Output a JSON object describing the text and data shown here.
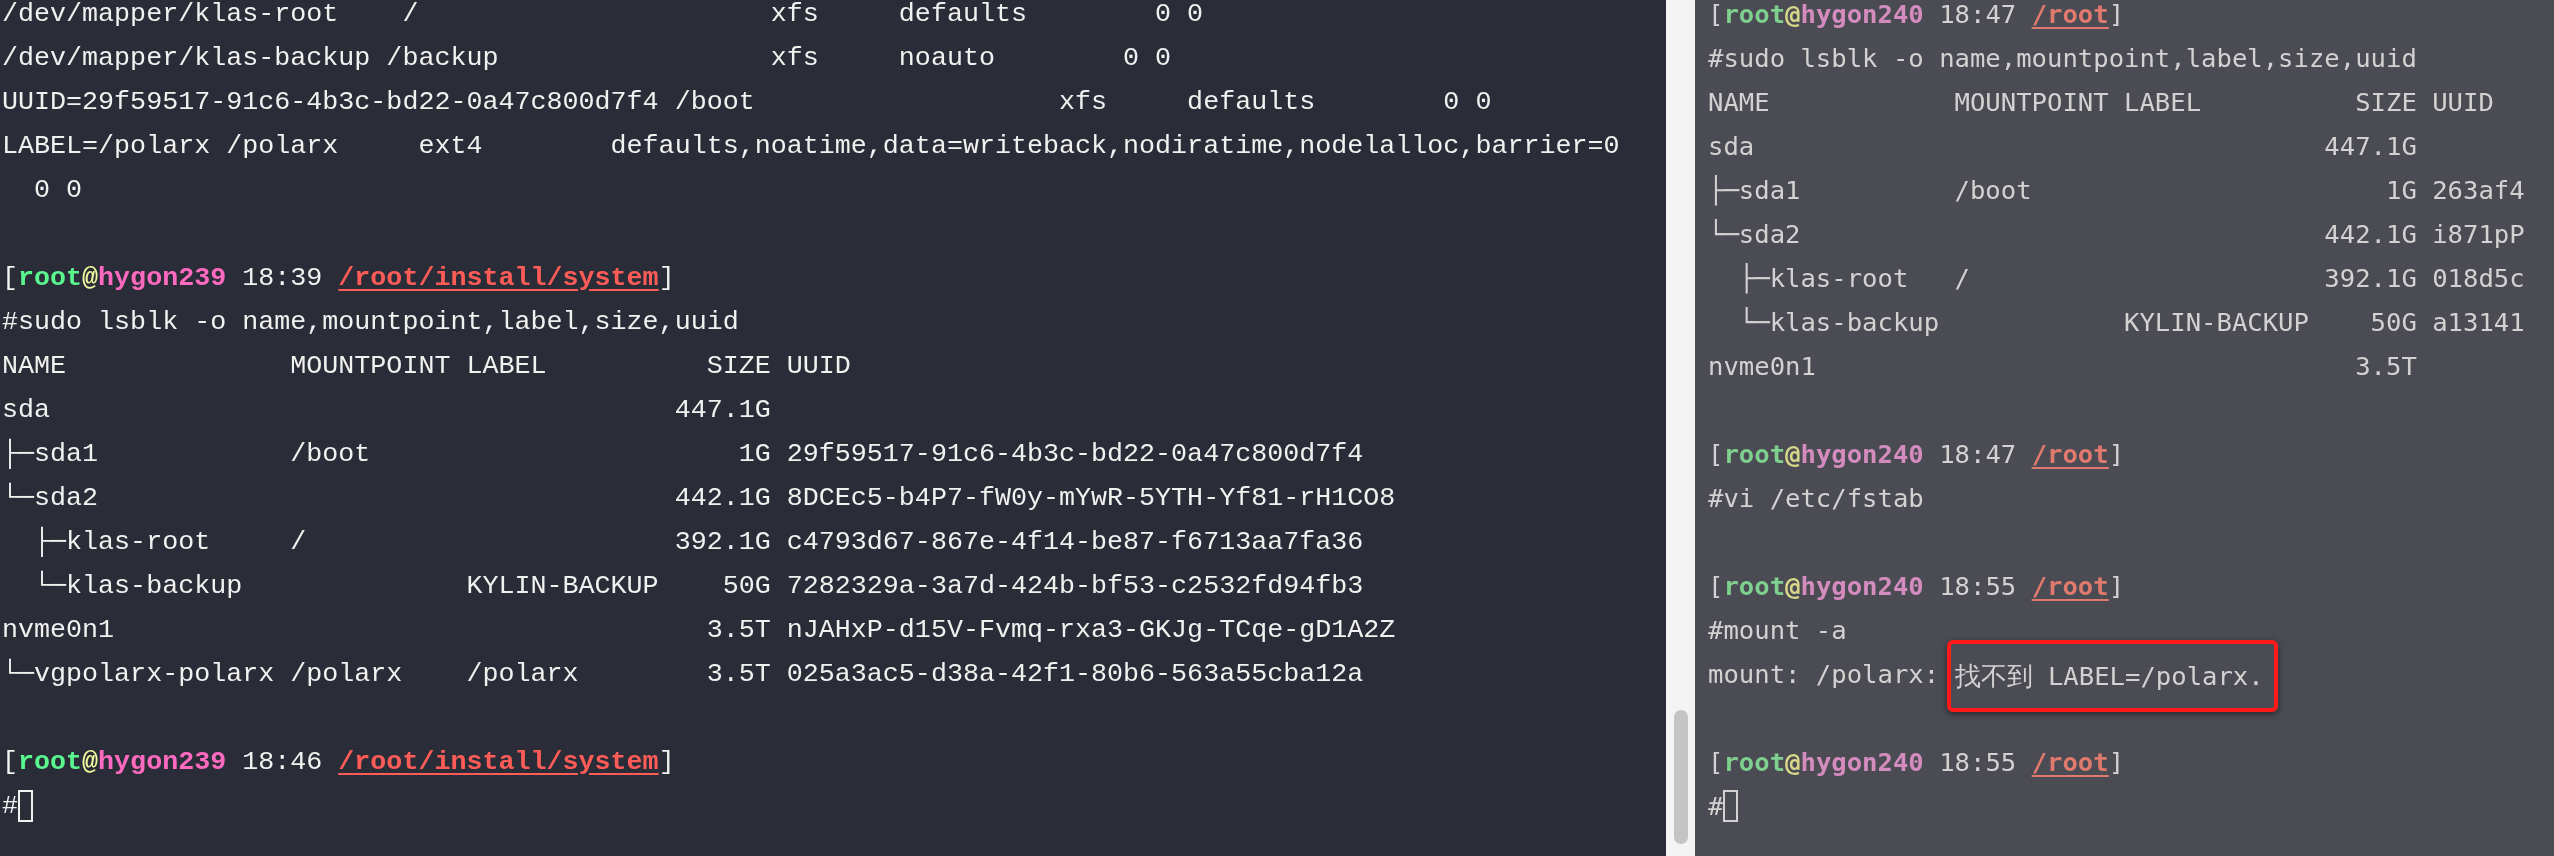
{
  "panes": [
    {
      "lines": [
        {
          "kind": "text",
          "segments": [
            {
              "kind": "plain",
              "text": "/dev/mapper/klas-root    /                      xfs     defaults        0 0"
            }
          ]
        },
        {
          "kind": "text",
          "segments": [
            {
              "kind": "plain",
              "text": "/dev/mapper/klas-backup /backup                 xfs     noauto        0 0"
            }
          ]
        },
        {
          "kind": "text",
          "segments": [
            {
              "kind": "plain",
              "text": "UUID=29f59517-91c6-4b3c-bd22-0a47c800d7f4 /boot                   xfs     defaults        0 0"
            }
          ]
        },
        {
          "kind": "text",
          "segments": [
            {
              "kind": "plain",
              "text": "LABEL=/polarx /polarx     ext4        defaults,noatime,data=writeback,nodiratime,nodelalloc,barrier=0"
            }
          ]
        },
        {
          "kind": "text",
          "segments": [
            {
              "kind": "plain",
              "text": "  0 0"
            }
          ]
        },
        {
          "kind": "blank"
        },
        {
          "kind": "text",
          "segments": [
            {
              "kind": "plain",
              "text": "["
            },
            {
              "kind": "user",
              "text": "root"
            },
            {
              "kind": "at",
              "text": "@"
            },
            {
              "kind": "host",
              "text": "hygon239"
            },
            {
              "kind": "plain",
              "text": " 18:39 "
            },
            {
              "kind": "path",
              "text": "/root/install/system"
            },
            {
              "kind": "plain",
              "text": "]"
            }
          ]
        },
        {
          "kind": "text",
          "segments": [
            {
              "kind": "plain",
              "text": "#sudo lsblk -o name,mountpoint,label,size,uuid"
            }
          ]
        },
        {
          "kind": "text",
          "segments": [
            {
              "kind": "plain",
              "text": "NAME              MOUNTPOINT LABEL          SIZE UUID"
            }
          ]
        },
        {
          "kind": "text",
          "segments": [
            {
              "kind": "plain",
              "text": "sda                                       447.1G"
            }
          ]
        },
        {
          "kind": "text",
          "segments": [
            {
              "kind": "plain",
              "text": "├─sda1            /boot                       1G 29f59517-91c6-4b3c-bd22-0a47c800d7f4"
            }
          ]
        },
        {
          "kind": "text",
          "segments": [
            {
              "kind": "plain",
              "text": "└─sda2                                    442.1G 8DCEc5-b4P7-fW0y-mYwR-5YTH-Yf81-rH1CO8"
            }
          ]
        },
        {
          "kind": "text",
          "segments": [
            {
              "kind": "plain",
              "text": "  ├─klas-root     /                       392.1G c4793d67-867e-4f14-be87-f6713aa7fa36"
            }
          ]
        },
        {
          "kind": "text",
          "segments": [
            {
              "kind": "plain",
              "text": "  └─klas-backup              KYLIN-BACKUP    50G 7282329a-3a7d-424b-bf53-c2532fd94fb3"
            }
          ]
        },
        {
          "kind": "text",
          "segments": [
            {
              "kind": "plain",
              "text": "nvme0n1                                     3.5T nJAHxP-d15V-Fvmq-rxa3-GKJg-TCqe-gD1A2Z"
            }
          ]
        },
        {
          "kind": "text",
          "segments": [
            {
              "kind": "plain",
              "text": "└─vgpolarx-polarx /polarx    /polarx        3.5T 025a3ac5-d38a-42f1-80b6-563a55cba12a"
            }
          ]
        },
        {
          "kind": "blank"
        },
        {
          "kind": "text",
          "segments": [
            {
              "kind": "plain",
              "text": "["
            },
            {
              "kind": "user",
              "text": "root"
            },
            {
              "kind": "at",
              "text": "@"
            },
            {
              "kind": "host",
              "text": "hygon239"
            },
            {
              "kind": "plain",
              "text": " 18:46 "
            },
            {
              "kind": "path",
              "text": "/root/install/system"
            },
            {
              "kind": "plain",
              "text": "]"
            }
          ]
        },
        {
          "kind": "input",
          "segments": [
            {
              "kind": "plain",
              "text": "#"
            }
          ]
        }
      ]
    },
    {
      "lines": [
        {
          "kind": "text",
          "segments": [
            {
              "kind": "plain",
              "text": "["
            },
            {
              "kind": "user",
              "text": "root"
            },
            {
              "kind": "at",
              "text": "@"
            },
            {
              "kind": "host",
              "text": "hygon240"
            },
            {
              "kind": "plain",
              "text": " 18:47 "
            },
            {
              "kind": "path",
              "text": "/root"
            },
            {
              "kind": "plain",
              "text": "]"
            }
          ]
        },
        {
          "kind": "text",
          "segments": [
            {
              "kind": "plain",
              "text": "#sudo lsblk -o name,mountpoint,label,size,uuid"
            }
          ]
        },
        {
          "kind": "text",
          "segments": [
            {
              "kind": "plain",
              "text": "NAME            MOUNTPOINT LABEL          SIZE UUID"
            }
          ]
        },
        {
          "kind": "text",
          "segments": [
            {
              "kind": "plain",
              "text": "sda                                     447.1G"
            }
          ]
        },
        {
          "kind": "text",
          "segments": [
            {
              "kind": "plain",
              "text": "├─sda1          /boot                       1G 263af4"
            }
          ]
        },
        {
          "kind": "text",
          "segments": [
            {
              "kind": "plain",
              "text": "└─sda2                                  442.1G i871pP"
            }
          ]
        },
        {
          "kind": "text",
          "segments": [
            {
              "kind": "plain",
              "text": "  ├─klas-root   /                       392.1G 018d5c"
            }
          ]
        },
        {
          "kind": "text",
          "segments": [
            {
              "kind": "plain",
              "text": "  └─klas-backup            KYLIN-BACKUP    50G a13141"
            }
          ]
        },
        {
          "kind": "text",
          "segments": [
            {
              "kind": "plain",
              "text": "nvme0n1                                   3.5T"
            }
          ]
        },
        {
          "kind": "blank"
        },
        {
          "kind": "text",
          "segments": [
            {
              "kind": "plain",
              "text": "["
            },
            {
              "kind": "user",
              "text": "root"
            },
            {
              "kind": "at",
              "text": "@"
            },
            {
              "kind": "host",
              "text": "hygon240"
            },
            {
              "kind": "plain",
              "text": " 18:47 "
            },
            {
              "kind": "path",
              "text": "/root"
            },
            {
              "kind": "plain",
              "text": "]"
            }
          ]
        },
        {
          "kind": "text",
          "segments": [
            {
              "kind": "plain",
              "text": "#vi /etc/fstab"
            }
          ]
        },
        {
          "kind": "blank"
        },
        {
          "kind": "text",
          "segments": [
            {
              "kind": "plain",
              "text": "["
            },
            {
              "kind": "user",
              "text": "root"
            },
            {
              "kind": "at",
              "text": "@"
            },
            {
              "kind": "host",
              "text": "hygon240"
            },
            {
              "kind": "plain",
              "text": " 18:55 "
            },
            {
              "kind": "path",
              "text": "/root"
            },
            {
              "kind": "plain",
              "text": "]"
            }
          ]
        },
        {
          "kind": "text",
          "segments": [
            {
              "kind": "plain",
              "text": "#mount -a"
            }
          ]
        },
        {
          "kind": "text",
          "segments": [
            {
              "kind": "plain",
              "text": "mount: /polarx: "
            },
            {
              "kind": "highlight",
              "text": "找不到 LABEL=/polarx."
            }
          ]
        },
        {
          "kind": "blank"
        },
        {
          "kind": "text",
          "segments": [
            {
              "kind": "plain",
              "text": "["
            },
            {
              "kind": "user",
              "text": "root"
            },
            {
              "kind": "at",
              "text": "@"
            },
            {
              "kind": "host",
              "text": "hygon240"
            },
            {
              "kind": "plain",
              "text": " 18:55 "
            },
            {
              "kind": "path",
              "text": "/root"
            },
            {
              "kind": "plain",
              "text": "]"
            }
          ]
        },
        {
          "kind": "input",
          "segments": [
            {
              "kind": "plain",
              "text": "#"
            }
          ]
        }
      ]
    }
  ]
}
